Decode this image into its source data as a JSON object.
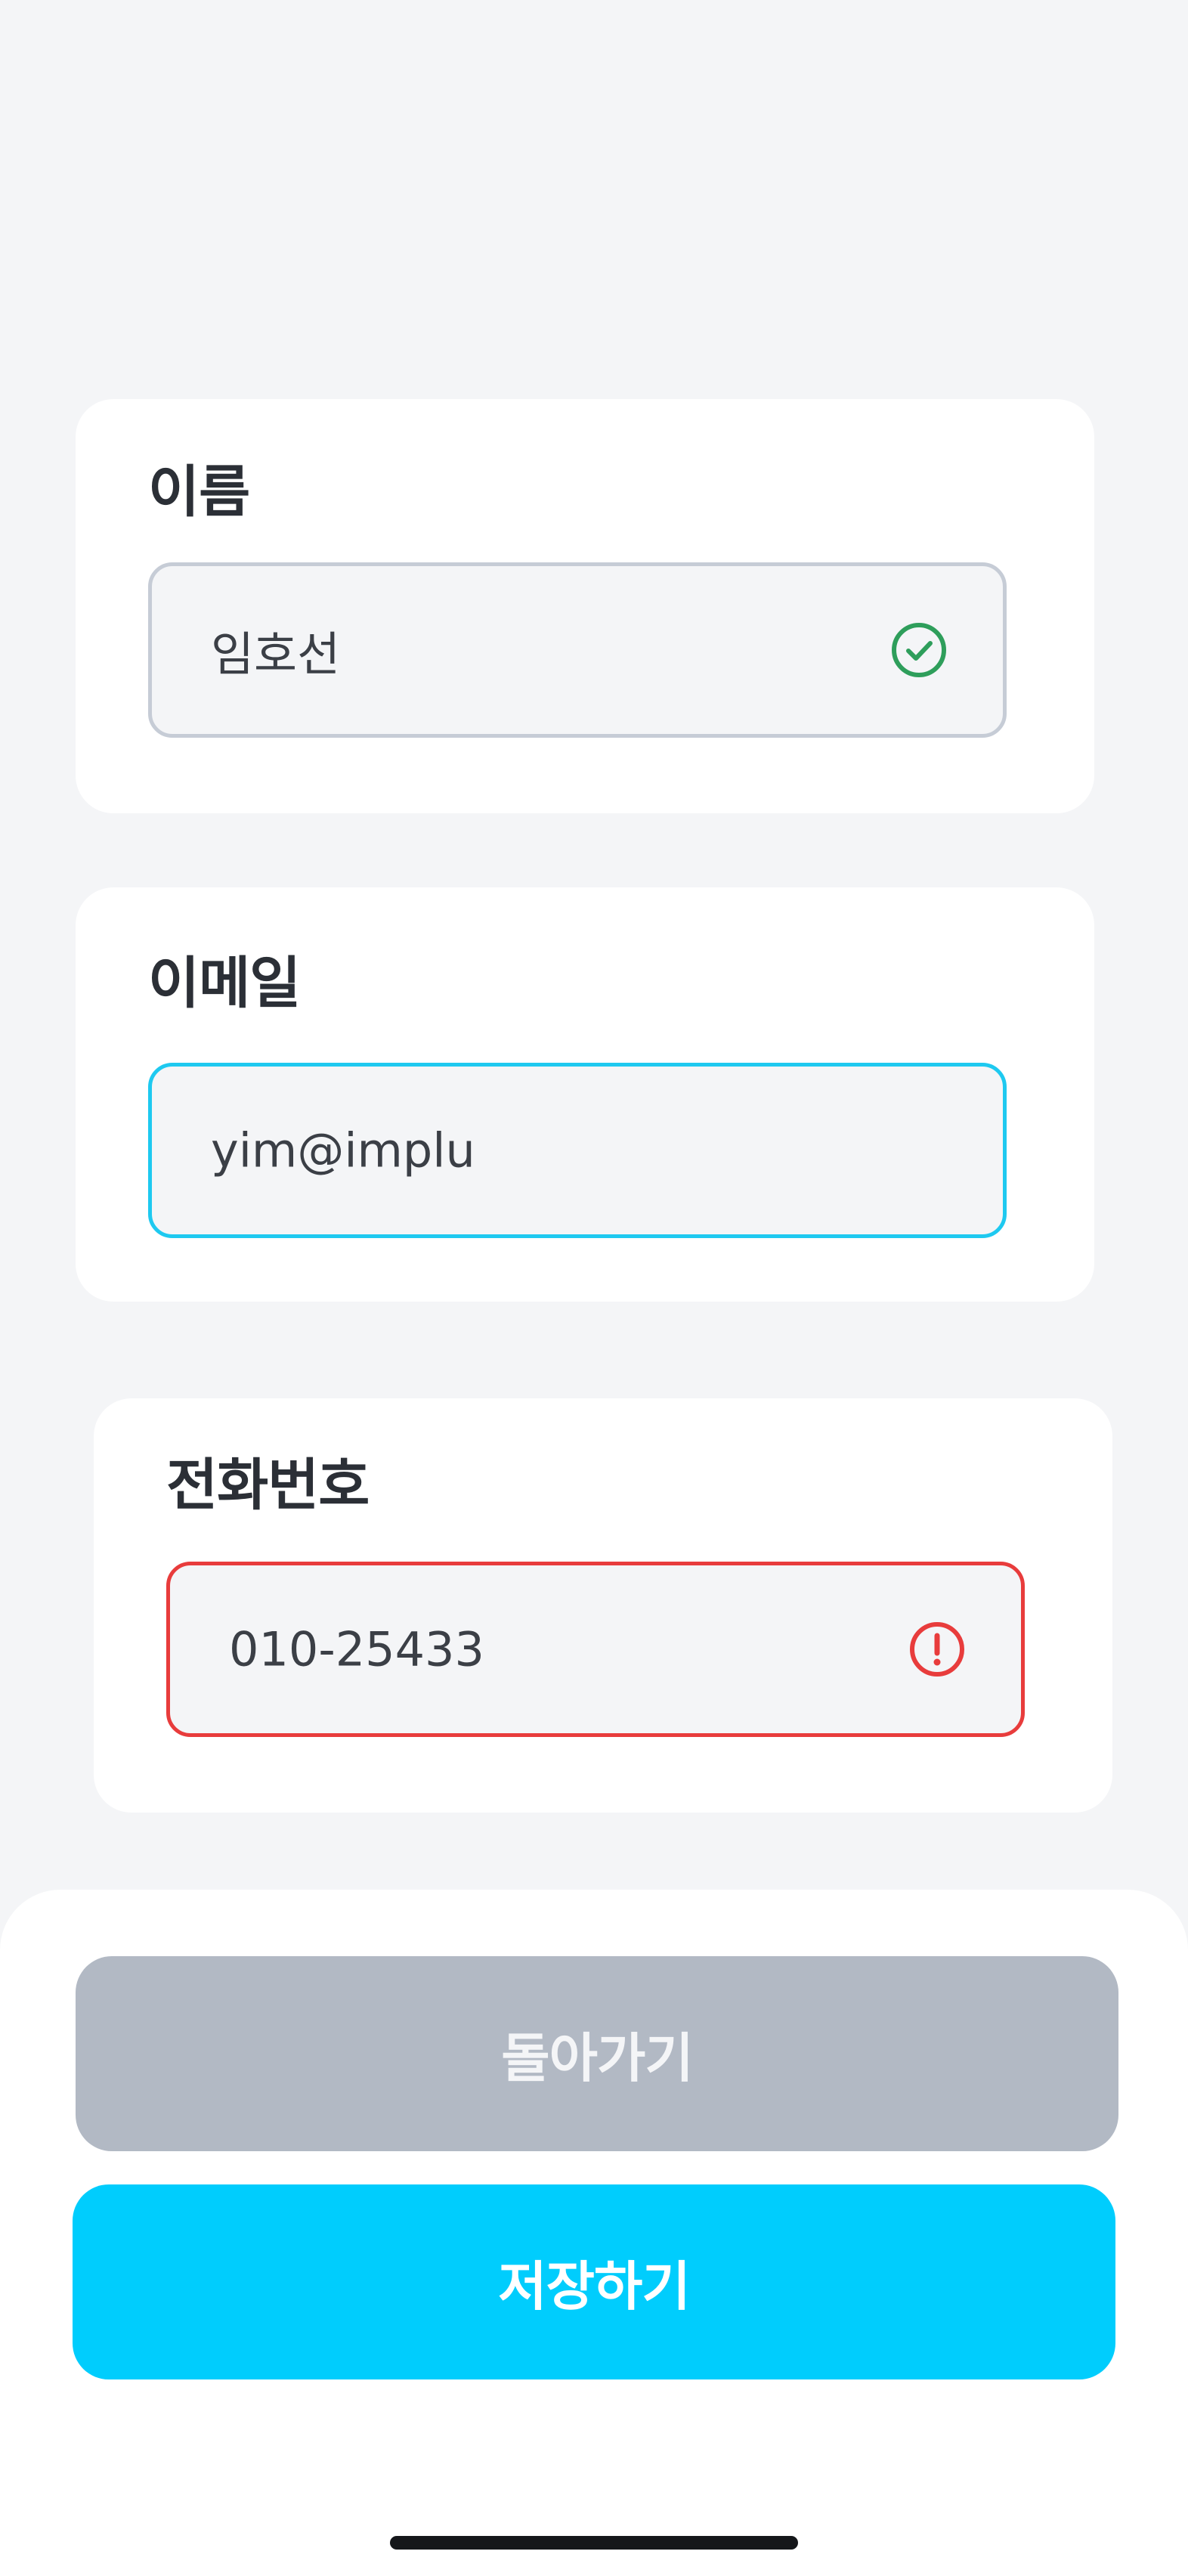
{
  "form": {
    "name": {
      "label": "이름",
      "value": "임호선",
      "status": "valid",
      "status_icon": "check-circle-icon"
    },
    "email": {
      "label": "이메일",
      "value": "yim@implu",
      "status": "focused"
    },
    "phone": {
      "label": "전화번호",
      "value": "010-25433",
      "status": "error",
      "status_icon": "alert-circle-icon"
    }
  },
  "actions": {
    "back_label": "돌아가기",
    "save_label": "저장하기"
  },
  "colors": {
    "background": "#f4f5f7",
    "valid": "#2e9e5b",
    "focus": "#1ec9f0",
    "error": "#e83c3c",
    "primary": "#00cdfd",
    "disabled": "#b2b9c4"
  }
}
